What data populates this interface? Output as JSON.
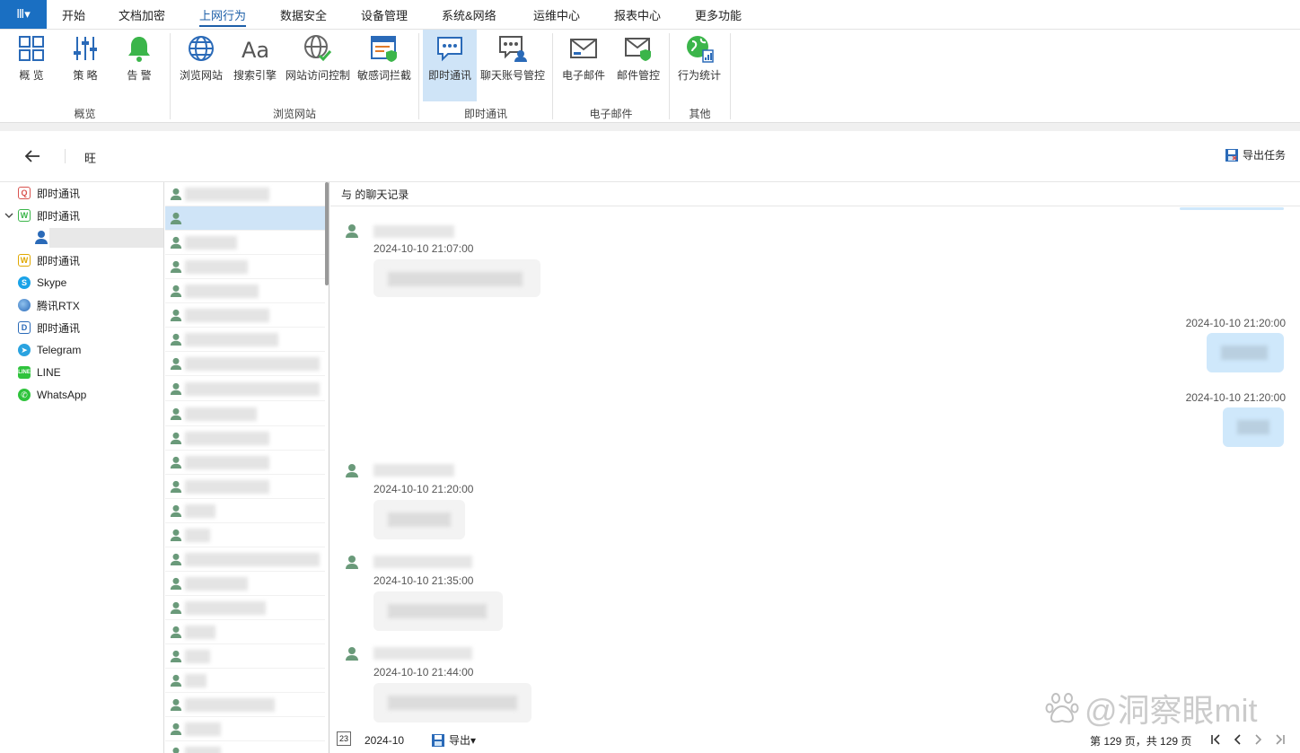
{
  "menu": {
    "app_icon": "Ⅲ▾",
    "items": [
      "开始",
      "文档加密",
      "上网行为",
      "数据安全",
      "设备管理",
      "系统&网络",
      "运维中心",
      "报表中心",
      "更多功能"
    ],
    "active": "上网行为"
  },
  "ribbon": {
    "buttons": [
      {
        "label": "概 览",
        "icon": "grid-icon"
      },
      {
        "label": "策 略",
        "icon": "sliders-icon"
      },
      {
        "label": "告 警",
        "icon": "bell-icon"
      },
      {
        "label": "浏览网站",
        "icon": "globe-icon"
      },
      {
        "label": "搜索引擎",
        "icon": "font-aa-icon"
      },
      {
        "label": "网站访问控制",
        "icon": "globe-check-icon"
      },
      {
        "label": "敏感词拦截",
        "icon": "browser-shield-icon"
      },
      {
        "label": "即时通讯",
        "icon": "chat-bubble-icon"
      },
      {
        "label": "聊天账号管控",
        "icon": "chat-user-icon"
      },
      {
        "label": "电子邮件",
        "icon": "envelope-icon"
      },
      {
        "label": "邮件管控",
        "icon": "envelope-shield-icon"
      },
      {
        "label": "行为统计",
        "icon": "globe-stats-icon"
      }
    ],
    "groups": [
      "概览",
      "浏览网站",
      "即时通讯",
      "电子邮件",
      "其他"
    ]
  },
  "toolbar": {
    "title": "旺",
    "export_task": "导出任务"
  },
  "tree": [
    {
      "label": "即时通讯",
      "icon": "q-icon",
      "color": "#d9534f"
    },
    {
      "label": "即时通讯",
      "icon": "w-icon",
      "color": "#3bb54a"
    },
    {
      "label": "",
      "icon": "user-icon",
      "color": "#2a6ab8"
    },
    {
      "label": "即时通讯",
      "icon": "w-icon",
      "color": "#e0a800"
    },
    {
      "label": "Skype",
      "icon": "skype-icon",
      "color": "#1aa3e8"
    },
    {
      "label": "腾讯RTX",
      "icon": "rtx-icon",
      "color": "#2a6ab8"
    },
    {
      "label": "即时通讯",
      "icon": "d-icon",
      "color": "#2a6ab8"
    },
    {
      "label": "Telegram",
      "icon": "telegram-icon",
      "color": "#2aa3e0"
    },
    {
      "label": "LINE",
      "icon": "line-icon",
      "color": "#2fc33c"
    },
    {
      "label": "WhatsApp",
      "icon": "whatsapp-icon",
      "color": "#2fc33c"
    }
  ],
  "chat": {
    "header": "与  的聊天记录",
    "messages": [
      {
        "side": "left",
        "time": "2024-10-10 21:07:00"
      },
      {
        "side": "right",
        "time": "2024-10-10 21:20:00"
      },
      {
        "side": "right",
        "time": "2024-10-10 21:20:00"
      },
      {
        "side": "left",
        "time": "2024-10-10 21:20:00"
      },
      {
        "side": "left",
        "time": "2024-10-10 21:35:00"
      },
      {
        "side": "left",
        "time": "2024-10-10 21:44:00"
      }
    ],
    "footer": {
      "date": "2024-10",
      "export": "导出▾",
      "pages": "第 129 页，共 129 页",
      "calendar_day": "23"
    }
  },
  "watermark": "@洞察眼mit",
  "colors": {
    "accent": "#1d5fa8",
    "selected": "#cfe4f7",
    "menu_bg": "#1a6fc2"
  }
}
